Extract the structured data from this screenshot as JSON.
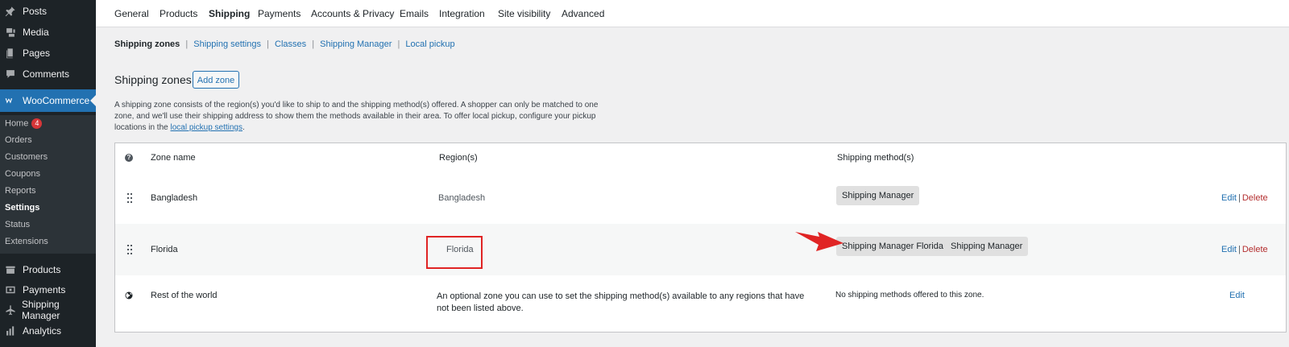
{
  "sidebar": {
    "top_items": [
      {
        "label": "Posts",
        "icon": "pin-icon"
      },
      {
        "label": "Media",
        "icon": "media-icon"
      },
      {
        "label": "Pages",
        "icon": "pages-icon"
      },
      {
        "label": "Comments",
        "icon": "comment-icon"
      }
    ],
    "woocommerce": {
      "label": "WooCommerce",
      "icon": "woo-icon"
    },
    "sub_items": [
      {
        "label": "Home",
        "badge": "4"
      },
      {
        "label": "Orders"
      },
      {
        "label": "Customers"
      },
      {
        "label": "Coupons"
      },
      {
        "label": "Reports"
      },
      {
        "label": "Settings",
        "current": true
      },
      {
        "label": "Status"
      },
      {
        "label": "Extensions"
      }
    ],
    "bottom_items": [
      {
        "label": "Products",
        "icon": "products-icon"
      },
      {
        "label": "Payments",
        "icon": "payments-icon"
      },
      {
        "label": "Shipping Manager",
        "icon": "plane-icon"
      },
      {
        "label": "Analytics",
        "icon": "analytics-icon"
      }
    ]
  },
  "tabs": [
    "General",
    "Products",
    "Shipping",
    "Payments",
    "Accounts & Privacy",
    "Emails",
    "Integration",
    "Site visibility",
    "Advanced"
  ],
  "active_tab": "Shipping",
  "subnav": [
    "Shipping zones",
    "Shipping settings",
    "Classes",
    "Shipping Manager",
    "Local pickup"
  ],
  "heading": "Shipping zones",
  "add_zone_label": "Add zone",
  "description": {
    "text": "A shipping zone consists of the region(s) you'd like to ship to and the shipping method(s) offered. A shopper can only be matched to one zone, and we'll use their shipping address to show them the methods available in their area. To offer local pickup, configure your pickup locations in the ",
    "link": "local pickup settings",
    "end": "."
  },
  "table": {
    "headers": {
      "help": "?",
      "zone_name": "Zone name",
      "regions": "Region(s)",
      "methods": "Shipping method(s)"
    },
    "rows": [
      {
        "zone": "Bangladesh",
        "region": "Bangladesh",
        "methods": [
          "Shipping Manager"
        ],
        "edit": "Edit",
        "delete": "Delete"
      },
      {
        "zone": "Florida",
        "region": "Florida",
        "methods": [
          "Shipping Manager Florida",
          "Shipping Manager"
        ],
        "edit": "Edit",
        "delete": "Delete"
      },
      {
        "zone": "Rest of the world",
        "region": "An optional zone you can use to set the shipping method(s) available to any regions that have not been listed above.",
        "methods_text": "No shipping methods offered to this zone.",
        "edit": "Edit"
      }
    ],
    "separator": "|"
  },
  "colors": {
    "accent": "#2271b1",
    "sidebar": "#1d2327",
    "annotation": "#e02424",
    "delete": "#b32d2e"
  }
}
